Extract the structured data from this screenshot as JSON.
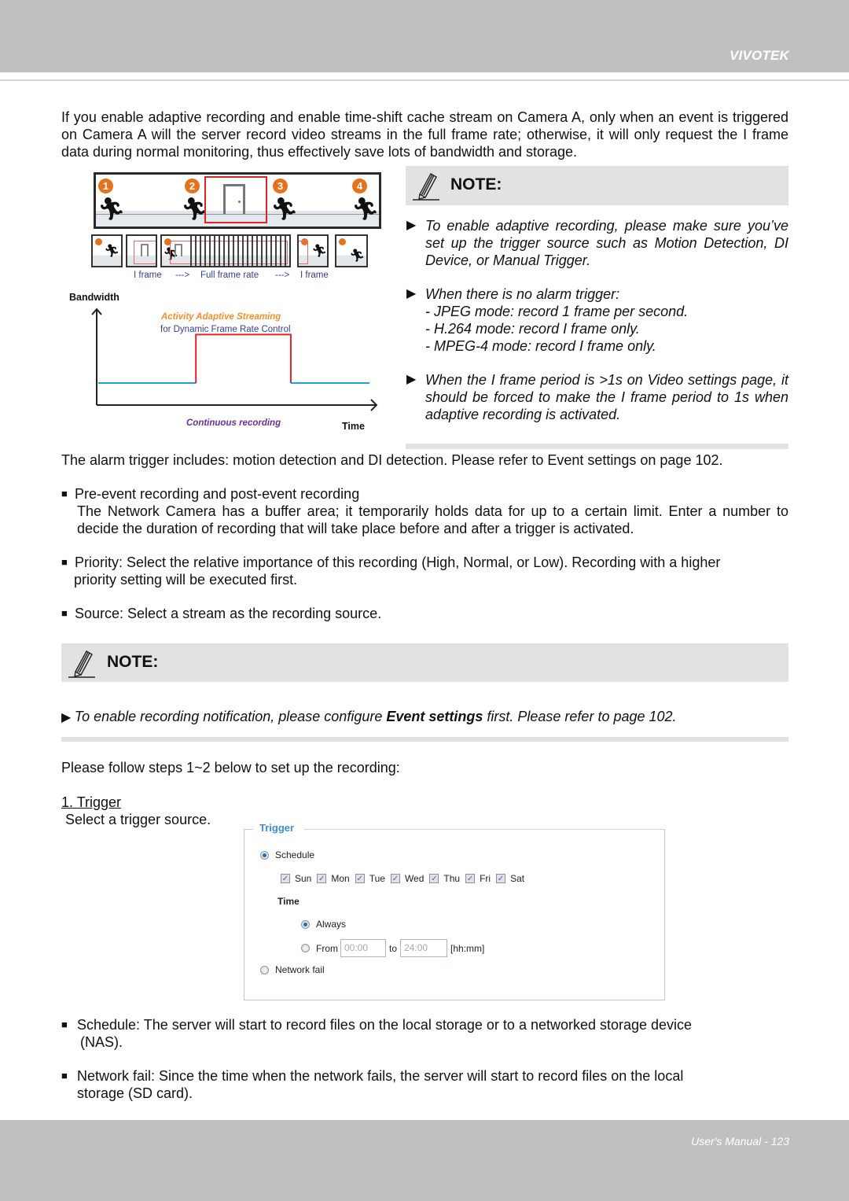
{
  "header": {
    "brand": "VIVOTEK"
  },
  "intro": "If you enable adaptive recording and enable time-shift cache stream on Camera A, only when an event is triggered on Camera A will the server record video streams in the full frame rate; otherwise, it will only request the I frame data during normal monitoring, thus effectively save lots of bandwidth and storage.",
  "figure": {
    "badges": [
      "1",
      "2",
      "3",
      "4"
    ],
    "frame_captions": [
      "I frame",
      "--->",
      "Full frame rate",
      "--->",
      "I frame"
    ],
    "bandwidth_label": "Bandwidth",
    "time_label": "Time",
    "aas_title": "Activity Adaptive Streaming",
    "aas_subtitle": "for Dynamic Frame Rate Control",
    "continuous_label": "Continuous recording",
    "colors": {
      "low": "#1da1e2",
      "high": "#e0242c",
      "accent": "#e5731b"
    }
  },
  "chart_data": {
    "type": "line",
    "title": "Activity Adaptive Streaming for Dynamic Frame Rate Control",
    "xlabel": "Time",
    "ylabel": "Bandwidth",
    "grid": false,
    "series": [
      {
        "name": "Continuous recording",
        "color": "#1da1e2",
        "x": [
          0,
          0.36
        ],
        "y": [
          0.25,
          0.25
        ]
      },
      {
        "name": "Activity Adaptive Streaming",
        "color": "#e0242c",
        "x": [
          0.36,
          0.36,
          0.71,
          0.71
        ],
        "y": [
          0.25,
          0.8,
          0.8,
          0.25
        ]
      },
      {
        "name": "Continuous recording",
        "color": "#1da1e2",
        "x": [
          0.71,
          1.0
        ],
        "y": [
          0.25,
          0.25
        ]
      }
    ],
    "xlim": [
      0,
      1
    ],
    "ylim": [
      0,
      1
    ]
  },
  "note1": {
    "title": "NOTE:",
    "items": [
      {
        "text": "To enable adaptive recording, please make sure you’ve set up the trigger source such as Motion Detection, DI Device, or Manual Trigger."
      },
      {
        "text": "When there is no alarm trigger:",
        "sub": [
          "- JPEG mode: record 1 frame per second.",
          "- H.264 mode: record I frame only.",
          "- MPEG-4 mode: record I frame only."
        ]
      },
      {
        "text": "When the I frame period is >1s on Video settings page, it should be forced to make the I frame period to 1s when adaptive recording is activated."
      }
    ]
  },
  "alarm_text": "The alarm trigger includes: motion detection and DI detection. Please refer to Event settings on page 102.",
  "bullets": [
    {
      "head": "Pre-event recording and post-event recording",
      "body": "The Network Camera has a buffer area; it temporarily holds data for up to a certain limit. Enter a number to decide the duration of recording that will take place before and after a trigger is activated."
    },
    {
      "head": "Priority: Select the relative importance of this recording (High, Normal, or Low). Recording with a higher",
      "cont": "priority setting will be executed first."
    },
    {
      "head": "Source: Select a stream as the recording source."
    }
  ],
  "note2": {
    "title": "NOTE:",
    "pre": "To enable recording notification, please configure ",
    "bold": "Event settings",
    "post": " first. Please refer to page 102."
  },
  "steps_intro": "Please follow steps 1~2 below to set up the recording:",
  "step1": {
    "title": "1. Trigger",
    "desc": "Select a trigger source."
  },
  "trigger_panel": {
    "legend": "Trigger",
    "schedule_label": "Schedule",
    "schedule_selected": true,
    "days": [
      {
        "label": "Sun",
        "checked": true
      },
      {
        "label": "Mon",
        "checked": true
      },
      {
        "label": "Tue",
        "checked": true
      },
      {
        "label": "Wed",
        "checked": true
      },
      {
        "label": "Thu",
        "checked": true
      },
      {
        "label": "Fri",
        "checked": true
      },
      {
        "label": "Sat",
        "checked": true
      }
    ],
    "time_label": "Time",
    "always_label": "Always",
    "always_selected": true,
    "from_label": "From",
    "from_value": "00:00",
    "to_label": "to",
    "to_value": "24:00",
    "format_hint": "[hh:mm]",
    "network_fail_label": "Network fail",
    "network_fail_selected": false
  },
  "bottom_bullets": [
    {
      "head": "Schedule: The server will start to record files on the local storage or to a networked storage device",
      "cont": "(NAS)."
    },
    {
      "head": "Network fail: Since the time when the network fails, the server will start to record files on the local",
      "cont": "storage (SD card)."
    }
  ],
  "footer": {
    "text": "User's Manual - 123"
  }
}
